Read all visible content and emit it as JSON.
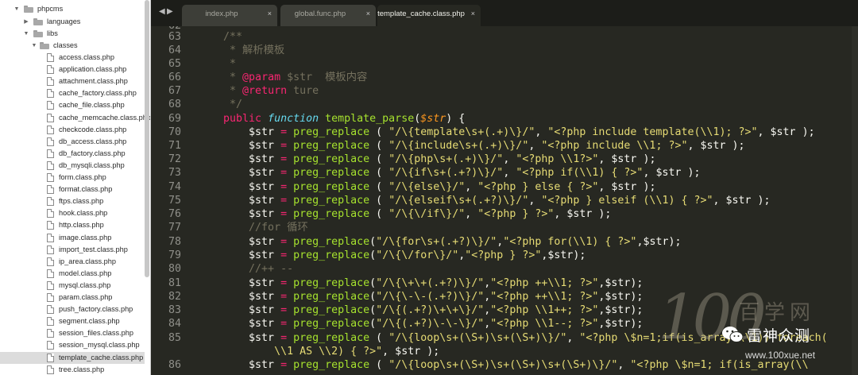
{
  "sidebar": {
    "folders": [
      {
        "label": "phpcms",
        "expanded": true
      },
      {
        "label": "languages",
        "expanded": false
      },
      {
        "label": "libs",
        "expanded": true
      },
      {
        "label": "classes",
        "expanded": true
      }
    ],
    "files": [
      "access.class.php",
      "application.class.php",
      "attachment.class.php",
      "cache_factory.class.php",
      "cache_file.class.php",
      "cache_memcache.class.php",
      "checkcode.class.php",
      "db_access.class.php",
      "db_factory.class.php",
      "db_mysqli.class.php",
      "form.class.php",
      "format.class.php",
      "ftps.class.php",
      "hook.class.php",
      "http.class.php",
      "image.class.php",
      "import_test.class.php",
      "ip_area.class.php",
      "model.class.php",
      "mysql.class.php",
      "param.class.php",
      "push_factory.class.php",
      "segment.class.php",
      "session_files.class.php",
      "session_mysql.class.php",
      "template_cache.class.php",
      "tree.class.php"
    ],
    "selected_file": "template_cache.class.php"
  },
  "tabs": [
    {
      "label": "index.php",
      "active": false
    },
    {
      "label": "global.func.php",
      "active": false
    },
    {
      "label": "template_cache.class.php",
      "active": true
    }
  ],
  "tab_close_symbol": "×",
  "nav": {
    "left": "◀",
    "right": "▶"
  },
  "editor": {
    "lines": [
      {
        "n": "62",
        "tokens": []
      },
      {
        "n": "63",
        "tokens": [
          [
            "c",
            "    /**"
          ]
        ]
      },
      {
        "n": "64",
        "tokens": [
          [
            "c",
            "     * 解析模板"
          ]
        ]
      },
      {
        "n": "65",
        "tokens": [
          [
            "c",
            "     *"
          ]
        ]
      },
      {
        "n": "66",
        "tokens": [
          [
            "c",
            "     * "
          ],
          [
            "k",
            "@param"
          ],
          [
            "c",
            " $str  模板内容"
          ]
        ]
      },
      {
        "n": "67",
        "tokens": [
          [
            "c",
            "     * "
          ],
          [
            "k",
            "@return"
          ],
          [
            "c",
            " ture"
          ]
        ]
      },
      {
        "n": "68",
        "tokens": [
          [
            "c",
            "     */"
          ]
        ]
      },
      {
        "n": "69",
        "tokens": [
          [
            "k",
            "    public "
          ],
          [
            "t",
            "function "
          ],
          [
            "f",
            "template_parse"
          ],
          [
            "d",
            "("
          ],
          [
            "v",
            "$str"
          ],
          [
            "d",
            ") {"
          ]
        ]
      },
      {
        "n": "70",
        "tokens": [
          [
            "d",
            "        $str "
          ],
          [
            "k",
            "= "
          ],
          [
            "f",
            "preg_replace"
          ],
          [
            "d",
            " ( "
          ],
          [
            "s",
            "\"/\\{template\\s+(.+)\\}/\""
          ],
          [
            "d",
            ", "
          ],
          [
            "s",
            "\"<?php include template(\\\\1); ?>\""
          ],
          [
            "d",
            ", $str );"
          ]
        ]
      },
      {
        "n": "71",
        "tokens": [
          [
            "d",
            "        $str "
          ],
          [
            "k",
            "= "
          ],
          [
            "f",
            "preg_replace"
          ],
          [
            "d",
            " ( "
          ],
          [
            "s",
            "\"/\\{include\\s+(.+)\\}/\""
          ],
          [
            "d",
            ", "
          ],
          [
            "s",
            "\"<?php include \\\\1; ?>\""
          ],
          [
            "d",
            ", $str );"
          ]
        ]
      },
      {
        "n": "72",
        "tokens": [
          [
            "d",
            "        $str "
          ],
          [
            "k",
            "= "
          ],
          [
            "f",
            "preg_replace"
          ],
          [
            "d",
            " ( "
          ],
          [
            "s",
            "\"/\\{php\\s+(.+)\\}/\""
          ],
          [
            "d",
            ", "
          ],
          [
            "s",
            "\"<?php \\\\1?>\""
          ],
          [
            "d",
            ", $str );"
          ]
        ]
      },
      {
        "n": "73",
        "tokens": [
          [
            "d",
            "        $str "
          ],
          [
            "k",
            "= "
          ],
          [
            "f",
            "preg_replace"
          ],
          [
            "d",
            " ( "
          ],
          [
            "s",
            "\"/\\{if\\s+(.+?)\\}/\""
          ],
          [
            "d",
            ", "
          ],
          [
            "s",
            "\"<?php if(\\\\1) { ?>\""
          ],
          [
            "d",
            ", $str );"
          ]
        ]
      },
      {
        "n": "74",
        "tokens": [
          [
            "d",
            "        $str "
          ],
          [
            "k",
            "= "
          ],
          [
            "f",
            "preg_replace"
          ],
          [
            "d",
            " ( "
          ],
          [
            "s",
            "\"/\\{else\\}/\""
          ],
          [
            "d",
            ", "
          ],
          [
            "s",
            "\"<?php } else { ?>\""
          ],
          [
            "d",
            ", $str );"
          ]
        ]
      },
      {
        "n": "75",
        "tokens": [
          [
            "d",
            "        $str "
          ],
          [
            "k",
            "= "
          ],
          [
            "f",
            "preg_replace"
          ],
          [
            "d",
            " ( "
          ],
          [
            "s",
            "\"/\\{elseif\\s+(.+?)\\}/\""
          ],
          [
            "d",
            ", "
          ],
          [
            "s",
            "\"<?php } elseif (\\\\1) { ?>\""
          ],
          [
            "d",
            ", $str );"
          ]
        ]
      },
      {
        "n": "76",
        "tokens": [
          [
            "d",
            "        $str "
          ],
          [
            "k",
            "= "
          ],
          [
            "f",
            "preg_replace"
          ],
          [
            "d",
            " ( "
          ],
          [
            "s",
            "\"/\\{\\/if\\}/\""
          ],
          [
            "d",
            ", "
          ],
          [
            "s",
            "\"<?php } ?>\""
          ],
          [
            "d",
            ", $str );"
          ]
        ]
      },
      {
        "n": "77",
        "tokens": [
          [
            "c",
            "        //for 循环"
          ]
        ]
      },
      {
        "n": "78",
        "tokens": [
          [
            "d",
            "        $str "
          ],
          [
            "k",
            "= "
          ],
          [
            "f",
            "preg_replace"
          ],
          [
            "d",
            "("
          ],
          [
            "s",
            "\"/\\{for\\s+(.+?)\\}/\""
          ],
          [
            "d",
            ","
          ],
          [
            "s",
            "\"<?php for(\\\\1) { ?>\""
          ],
          [
            "d",
            ",$str);"
          ]
        ]
      },
      {
        "n": "79",
        "tokens": [
          [
            "d",
            "        $str "
          ],
          [
            "k",
            "= "
          ],
          [
            "f",
            "preg_replace"
          ],
          [
            "d",
            "("
          ],
          [
            "s",
            "\"/\\{\\/for\\}/\""
          ],
          [
            "d",
            ","
          ],
          [
            "s",
            "\"<?php } ?>\""
          ],
          [
            "d",
            ",$str);"
          ]
        ]
      },
      {
        "n": "80",
        "tokens": [
          [
            "c",
            "        //++ --"
          ]
        ]
      },
      {
        "n": "81",
        "tokens": [
          [
            "d",
            "        $str "
          ],
          [
            "k",
            "= "
          ],
          [
            "f",
            "preg_replace"
          ],
          [
            "d",
            "("
          ],
          [
            "s",
            "\"/\\{\\+\\+(.+?)\\}/\""
          ],
          [
            "d",
            ","
          ],
          [
            "s",
            "\"<?php ++\\\\1; ?>\""
          ],
          [
            "d",
            ",$str);"
          ]
        ]
      },
      {
        "n": "82",
        "tokens": [
          [
            "d",
            "        $str "
          ],
          [
            "k",
            "= "
          ],
          [
            "f",
            "preg_replace"
          ],
          [
            "d",
            "("
          ],
          [
            "s",
            "\"/\\{\\-\\-(.+?)\\}/\""
          ],
          [
            "d",
            ","
          ],
          [
            "s",
            "\"<?php ++\\\\1; ?>\""
          ],
          [
            "d",
            ",$str);"
          ]
        ]
      },
      {
        "n": "83",
        "tokens": [
          [
            "d",
            "        $str "
          ],
          [
            "k",
            "= "
          ],
          [
            "f",
            "preg_replace"
          ],
          [
            "d",
            "("
          ],
          [
            "s",
            "\"/\\{(.+?)\\+\\+\\}/\""
          ],
          [
            "d",
            ","
          ],
          [
            "s",
            "\"<?php \\\\1++; ?>\""
          ],
          [
            "d",
            ",$str);"
          ]
        ]
      },
      {
        "n": "84",
        "tokens": [
          [
            "d",
            "        $str "
          ],
          [
            "k",
            "= "
          ],
          [
            "f",
            "preg_replace"
          ],
          [
            "d",
            "("
          ],
          [
            "s",
            "\"/\\{(.+?)\\-\\-\\}/\""
          ],
          [
            "d",
            ","
          ],
          [
            "s",
            "\"<?php \\\\1--; ?>\""
          ],
          [
            "d",
            ",$str);"
          ]
        ]
      },
      {
        "n": "85",
        "tokens": [
          [
            "d",
            "        $str "
          ],
          [
            "k",
            "= "
          ],
          [
            "f",
            "preg_replace"
          ],
          [
            "d",
            " ( "
          ],
          [
            "s",
            "\"/\\{loop\\s+(\\S+)\\s+(\\S+)\\}/\""
          ],
          [
            "d",
            ", "
          ],
          [
            "s",
            "\"<?php \\$n=1;if(is_array(\\\\1)) foreach("
          ]
        ]
      },
      {
        "n": "",
        "tokens": [
          [
            "s",
            "            \\\\1 AS \\\\2) { ?>\""
          ],
          [
            "d",
            ", $str );"
          ]
        ]
      },
      {
        "n": "86",
        "tokens": [
          [
            "d",
            "        $str "
          ],
          [
            "k",
            "= "
          ],
          [
            "f",
            "preg_replace"
          ],
          [
            "d",
            " ( "
          ],
          [
            "s",
            "\"/\\{loop\\s+(\\S+)\\s+(\\S+)\\s+(\\S+)\\}/\""
          ],
          [
            "d",
            ", "
          ],
          [
            "s",
            "\"<?php \\$n=1; if(is_array(\\\\"
          ]
        ]
      }
    ]
  },
  "watermark": {
    "number": "100",
    "site_cn": "百学网",
    "brand": "雷神众测",
    "url": "www.100xue.net"
  }
}
